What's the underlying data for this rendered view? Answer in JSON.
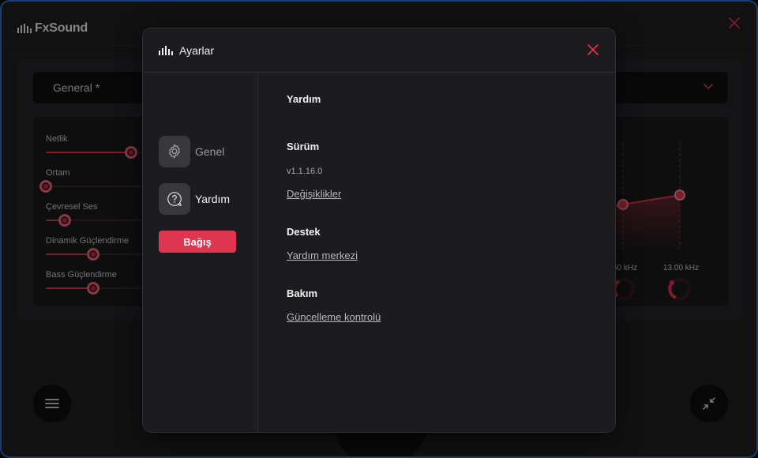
{
  "app": {
    "name": "FxSound",
    "preset": "General *",
    "effects": [
      {
        "label": "Netlik",
        "value": 0.86
      },
      {
        "label": "Ortam",
        "value": 0.0
      },
      {
        "label": "Çevresel Ses",
        "value": 0.2
      },
      {
        "label": "Dinamik Güçlendirme",
        "value": 0.5
      },
      {
        "label": "Bass Güçlendirme",
        "value": 0.5
      }
    ],
    "eq": {
      "freq_labels": [
        "50 kHz",
        "13.00 kHz"
      ]
    }
  },
  "dialog": {
    "title": "Ayarlar",
    "nav": [
      {
        "label": "Genel",
        "icon": "gear-icon",
        "active": false
      },
      {
        "label": "Yardım",
        "icon": "help-icon",
        "active": true
      }
    ],
    "donate_label": "Bağış",
    "content": {
      "heading": "Yardım",
      "version_title": "Sürüm",
      "version_value": "v1.1.16.0",
      "changelog_link": "Değişiklikler",
      "support_title": "Destek",
      "help_center_link": "Yardım merkezi",
      "maintenance_title": "Bakım",
      "update_check_link": "Güncelleme kontrolü"
    }
  },
  "colors": {
    "accent": "#e0354f",
    "background": "#1f1f22",
    "dialog": "#1c1c1e"
  }
}
